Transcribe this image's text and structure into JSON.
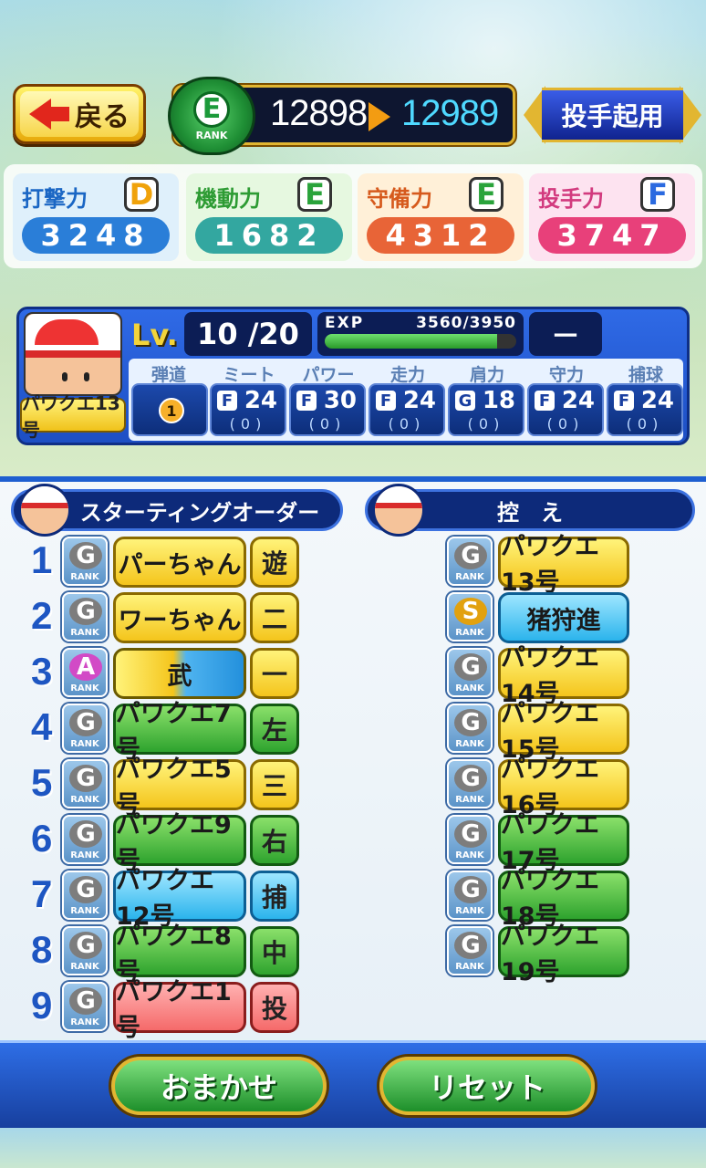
{
  "header": {
    "back_label": "戻る",
    "team_rank": "E",
    "rank_word": "RANK",
    "rank_from": "12898",
    "rank_to": "12989",
    "pitcher_button": "投手起用"
  },
  "team_stats": [
    {
      "label": "打撃力",
      "grade": "D",
      "value": "3248",
      "color": "#2a7ed8"
    },
    {
      "label": "機動力",
      "grade": "E",
      "value": "1682",
      "color": "#33a7a0"
    },
    {
      "label": "守備力",
      "grade": "E",
      "value": "4312",
      "color": "#e86437"
    },
    {
      "label": "投手力",
      "grade": "F",
      "value": "3747",
      "color": "#e8407a"
    }
  ],
  "player": {
    "name": "パワクエ13号",
    "lv_label": "Lv.",
    "level": "10 /20",
    "exp_label": "EXP",
    "exp_value": "3560/3950",
    "exp_fraction": 0.9,
    "slot": "－",
    "trajectory_head": "弾道",
    "trajectory": "1",
    "abilities": [
      {
        "head": "ミート",
        "grade": "F",
        "value": "24",
        "sub": "(0)"
      },
      {
        "head": "パワー",
        "grade": "F",
        "value": "30",
        "sub": "(0)"
      },
      {
        "head": "走力",
        "grade": "F",
        "value": "24",
        "sub": "(0)"
      },
      {
        "head": "肩力",
        "grade": "G",
        "value": "18",
        "sub": "(0)"
      },
      {
        "head": "守力",
        "grade": "F",
        "value": "24",
        "sub": "(0)"
      },
      {
        "head": "捕球",
        "grade": "F",
        "value": "24",
        "sub": "(0)"
      }
    ]
  },
  "lineup": {
    "title": "スターティングオーダー",
    "rows": [
      {
        "num": "1",
        "rank": "G",
        "name": "パーちゃん",
        "color": "yellow",
        "pos": "遊",
        "poscolor": "yellow"
      },
      {
        "num": "2",
        "rank": "G",
        "name": "ワーちゃん",
        "color": "yellow",
        "pos": "二",
        "poscolor": "yellow"
      },
      {
        "num": "3",
        "rank": "A",
        "name": "武",
        "color": "mixed",
        "pos": "一",
        "poscolor": "yellow"
      },
      {
        "num": "4",
        "rank": "G",
        "name": "パワクエ7号",
        "color": "green",
        "pos": "左",
        "poscolor": "green"
      },
      {
        "num": "5",
        "rank": "G",
        "name": "パワクエ5号",
        "color": "yellow",
        "pos": "三",
        "poscolor": "yellow"
      },
      {
        "num": "6",
        "rank": "G",
        "name": "パワクエ9号",
        "color": "green",
        "pos": "右",
        "poscolor": "green"
      },
      {
        "num": "7",
        "rank": "G",
        "name": "パワクエ12号",
        "color": "blue",
        "pos": "捕",
        "poscolor": "blue"
      },
      {
        "num": "8",
        "rank": "G",
        "name": "パワクエ8号",
        "color": "green",
        "pos": "中",
        "poscolor": "green"
      },
      {
        "num": "9",
        "rank": "G",
        "name": "パワクエ1号",
        "color": "red",
        "pos": "投",
        "poscolor": "red"
      }
    ]
  },
  "bench": {
    "title": "控　え",
    "rows": [
      {
        "rank": "G",
        "name": "パワクエ13号",
        "color": "yellow"
      },
      {
        "rank": "S",
        "name": "猪狩進",
        "color": "blue"
      },
      {
        "rank": "G",
        "name": "パワクエ14号",
        "color": "yellow"
      },
      {
        "rank": "G",
        "name": "パワクエ15号",
        "color": "yellow"
      },
      {
        "rank": "G",
        "name": "パワクエ16号",
        "color": "yellow"
      },
      {
        "rank": "G",
        "name": "パワクエ17号",
        "color": "green"
      },
      {
        "rank": "G",
        "name": "パワクエ18号",
        "color": "green"
      },
      {
        "rank": "G",
        "name": "パワクエ19号",
        "color": "green"
      }
    ]
  },
  "footer": {
    "auto_label": "おまかせ",
    "reset_label": "リセット"
  }
}
